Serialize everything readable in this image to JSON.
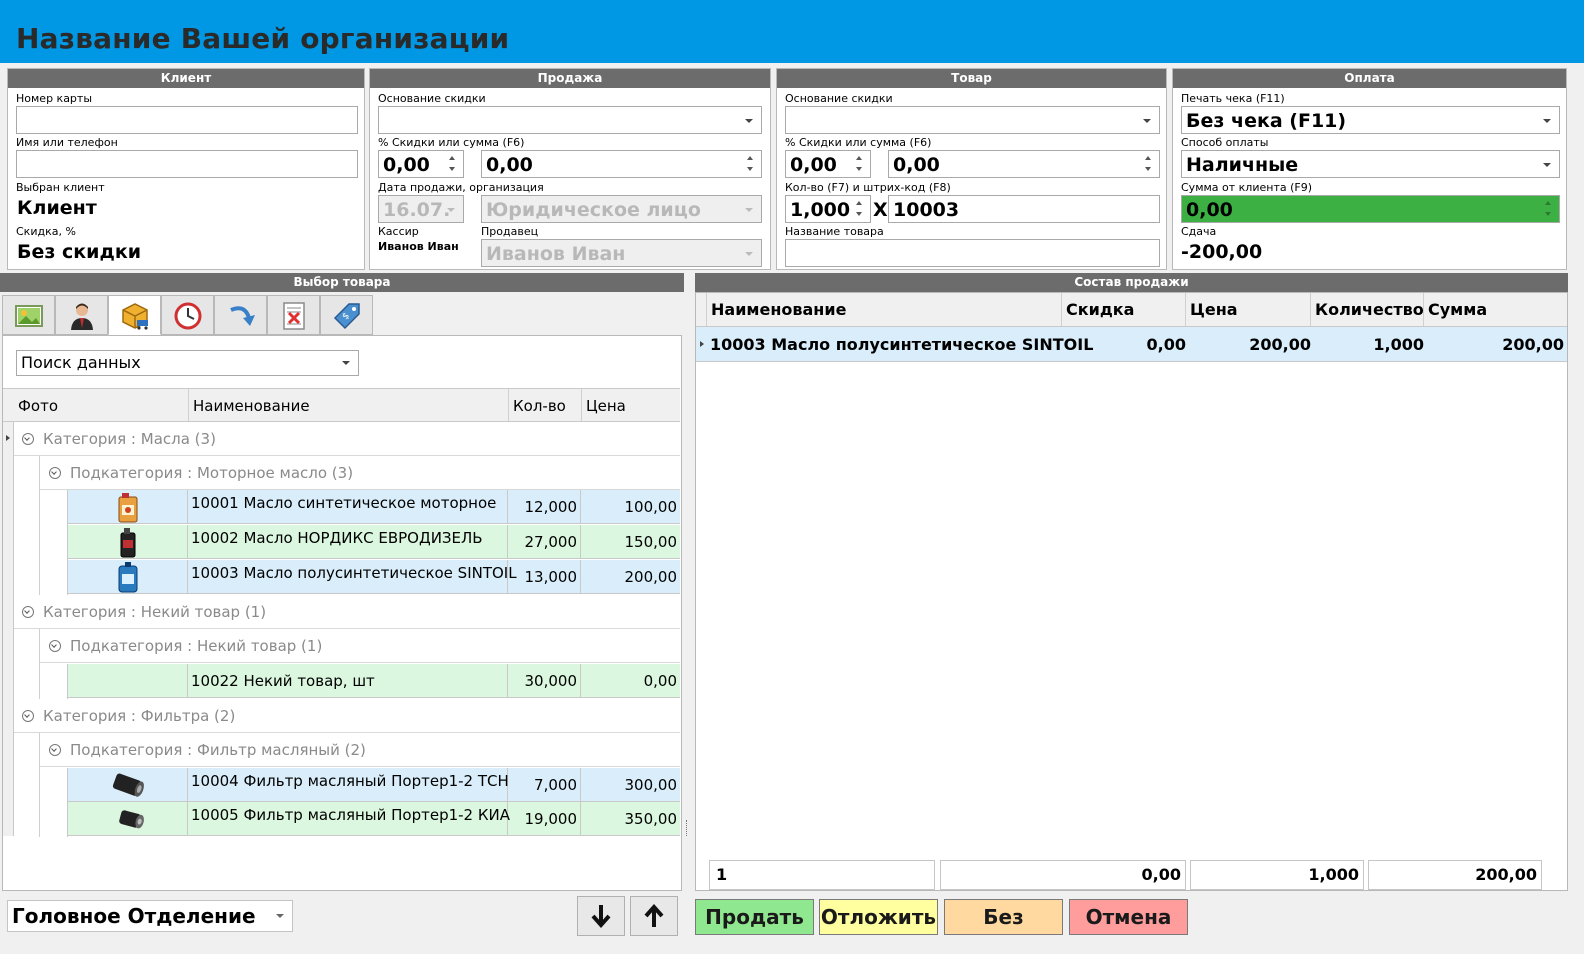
{
  "app": {
    "title": "Название Вашей организации"
  },
  "client": {
    "title": "Клиент",
    "card_label": "Номер карты",
    "card_value": "",
    "name_label": "Имя или телефон",
    "name_value": "",
    "selected_label": "Выбран клиент",
    "selected_value": "Клиент",
    "discount_label": "Скидка, %",
    "discount_value": "Без скидки"
  },
  "sale": {
    "title": "Продажа",
    "basis_label": "Основание скидки",
    "basis_value": "",
    "pct_label": "% Скидки или сумма (F6)",
    "pct_value": "0,00",
    "sum_value": "0,00",
    "date_label": "Дата продажи, организация",
    "date_value": "16.07.",
    "org_value": "Юридическое лицо",
    "cashier_label": "Кассир",
    "cashier_value": "Иванов Иван",
    "seller_label": "Продавец",
    "seller_value": "Иванов Иван"
  },
  "product": {
    "title": "Товар",
    "basis_label": "Основание скидки",
    "basis_value": "",
    "pct_label": "% Скидки или сумма (F6)",
    "pct_value": "0,00",
    "sum_value": "0,00",
    "qty_label": "Кол-во (F7) и штрих-код (F8)",
    "qty_value": "1,000",
    "x_sign": "X",
    "barcode_value": "10003",
    "name_label": "Название товара",
    "name_value": ""
  },
  "payment": {
    "title": "Оплата",
    "print_label": "Печать чека (F11)",
    "print_value": "Без чека (F11)",
    "method_label": "Способ оплаты",
    "method_value": "Наличные",
    "client_sum_label": "Сумма от клиента (F9)",
    "client_sum_value": "0,00",
    "change_label": "Сдача",
    "change_value": "-200,00",
    "client_sum_color": "#3cb043"
  },
  "selection": {
    "title": "Выбор товара",
    "tabs": [
      "picture-icon",
      "user-icon",
      "box-cart-icon",
      "clock-icon",
      "redo-arrow-icon",
      "delete-list-icon",
      "price-tag-icon"
    ],
    "search_value": "Поиск данных",
    "columns": {
      "photo": "Фото",
      "name": "Наименование",
      "qty": "Кол-во",
      "price": "Цена"
    },
    "cat1": "Категория : Масла (3)",
    "sub1": "Подкатегория : Моторное масло (3)",
    "items1": [
      {
        "name": "10001 Масло синтетическое моторное",
        "qty": "12,000",
        "price": "100,00"
      },
      {
        "name": "10002 Масло НОРДИКС ЕВРОДИЗЕЛЬ",
        "qty": "27,000",
        "price": "150,00"
      },
      {
        "name": "10003 Масло полусинтетическое SINTOIL",
        "qty": "13,000",
        "price": "200,00"
      }
    ],
    "cat2": "Категория : Некий товар (1)",
    "sub2": "Подкатегория : Некий товар (1)",
    "items2": [
      {
        "name": "10022 Некий товар, шт",
        "qty": "30,000",
        "price": "0,00"
      }
    ],
    "cat3": "Категория : Фильтра (2)",
    "sub3": "Подкатегория : Фильтр масляный (2)",
    "items3": [
      {
        "name": "10004 Фильтр масляный Портер1-2 ТСН",
        "qty": "7,000",
        "price": "300,00"
      },
      {
        "name": "10005 Фильтр масляный Портер1-2 КИА",
        "qty": "19,000",
        "price": "350,00"
      }
    ],
    "branch_value": "Головное Отделение"
  },
  "composition": {
    "title": "Состав продажи",
    "columns": {
      "name": "Наименование",
      "discount": "Скидка",
      "price": "Цена",
      "qty": "Количество",
      "sum": "Сумма"
    },
    "rows": [
      {
        "name": "10003 Масло полусинтетическое SINTOIL",
        "discount": "0,00",
        "price": "200,00",
        "qty": "1,000",
        "sum": "200,00"
      }
    ],
    "footer": {
      "count": "1",
      "discount": "0,00",
      "qty": "1,000",
      "sum": "200,00"
    }
  },
  "actions": {
    "sell": "Продать",
    "defer": "Отложить",
    "without": "Без",
    "cancel": "Отмена",
    "sell_color": "#8fe88f",
    "defer_color": "#ffffa0",
    "without_color": "#ffd9a0",
    "cancel_color": "#ff9c9c"
  }
}
